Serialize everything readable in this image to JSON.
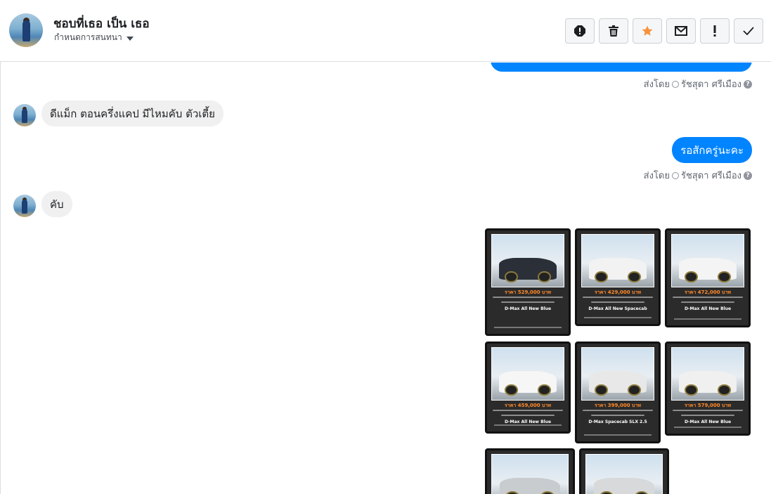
{
  "header": {
    "name": "ชอบที่เธอ เป็น เธอ",
    "subtitle": "กำหนดการสนทนา"
  },
  "toolbar": [
    {
      "name": "report-icon",
      "color": "#1c1e21"
    },
    {
      "name": "trash-icon",
      "color": "#1c1e21"
    },
    {
      "name": "star-icon",
      "color": "#f7923b"
    },
    {
      "name": "envelope-icon",
      "color": "#1c1e21"
    },
    {
      "name": "exclamation-icon",
      "color": "#1c1e21"
    },
    {
      "name": "check-icon",
      "color": "#1c1e21"
    }
  ],
  "messages": {
    "sent_by_1": "ส่งโดย",
    "agent_1": "รัชสุดา ศรีเมือง",
    "incoming_1": "ดีแม็ก ตอนครึ่งแคป มีไหมคับ ตัวเตี้ย",
    "outgoing_2": "รอสักครู่นะคะ",
    "sent_by_2": "ส่งโดย",
    "agent_2": "รัชสุดา ศรีเมือง",
    "incoming_2": "คับ"
  },
  "cards": [
    {
      "price": "ราคา 529,000 บาท",
      "model": "D-Max All New Blue",
      "car_color": "#2b3038"
    },
    {
      "price": "ราคา 429,000 บาท",
      "model": "D-Max All New Spacecab",
      "car_color": "#f2f2f2"
    },
    {
      "price": "ราคา 472,000 บาท",
      "model": "D-Max All New Blue",
      "car_color": "#f4f4f4"
    },
    {
      "price": "ราคา 459,000 บาท",
      "model": "D-Max All New Blue",
      "car_color": "#f6f6f6"
    },
    {
      "price": "ราคา 399,000 บาท",
      "model": "D-Max Spacecab SLX 2.5",
      "car_color": "#e8e8e8"
    },
    {
      "price": "ราคา 579,000 บาท",
      "model": "D-Max All New Blue",
      "car_color": "#f0f0f0"
    },
    {
      "price": "",
      "model": "",
      "car_color": "#c9ccce"
    },
    {
      "price": "",
      "model": "",
      "car_color": "#d7d9da"
    }
  ]
}
